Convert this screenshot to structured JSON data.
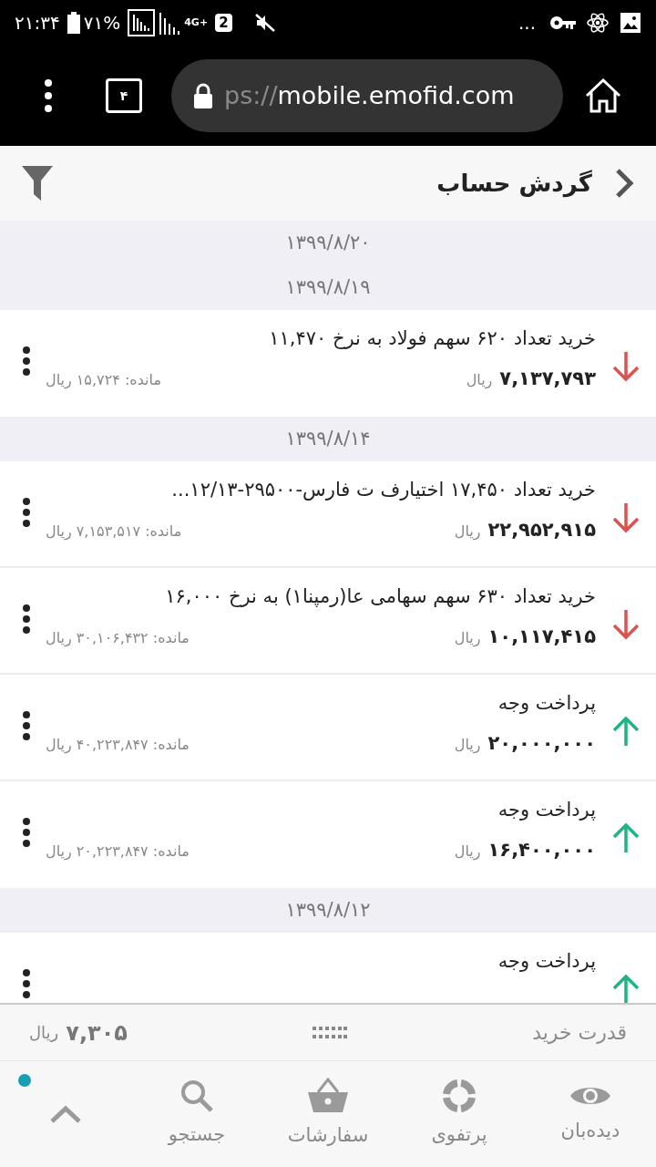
{
  "status_bar": {
    "time": "۲۱:۳۴",
    "battery": "۷۱%",
    "network": "4G+",
    "sim": "2",
    "more": "..."
  },
  "browser": {
    "tabs_count": "۴",
    "url_prefix": "ps://",
    "url_host": "mobile.emofid.com"
  },
  "header": {
    "title": "گردش حساب"
  },
  "groups": [
    {
      "date": "۱۳۹۹/۸/۲۰"
    },
    {
      "date": "۱۳۹۹/۸/۱۹",
      "rows": [
        {
          "kind": "debit",
          "title": "خرید تعداد ۶۲۰ سهم فولاد به نرخ ۱۱,۴۷۰",
          "amount": "۷,۱۳۷,۷۹۳",
          "currency": "ریال",
          "balance": "مانده: ۱۵,۷۲۴ ریال"
        }
      ]
    },
    {
      "date": "۱۳۹۹/۸/۱۴",
      "rows": [
        {
          "kind": "debit",
          "title": "خرید تعداد ۱۷,۴۵۰ اختیارف ت فارس-۲۹۵۰۰-۱۲/۱۳...",
          "amount": "۲۲,۹۵۲,۹۱۵",
          "currency": "ریال",
          "balance": "مانده: ۷,۱۵۳,۵۱۷ ریال"
        },
        {
          "kind": "debit",
          "title": "خرید تعداد ۶۳۰ سهم سهامی عا(رمپنا۱) به نرخ ۱۶,۰۰۰",
          "amount": "۱۰,۱۱۷,۴۱۵",
          "currency": "ریال",
          "balance": "مانده: ۳۰,۱۰۶,۴۳۲ ریال"
        },
        {
          "kind": "credit",
          "title": "پرداخت وجه",
          "amount": "۲۰,۰۰۰,۰۰۰",
          "currency": "ریال",
          "balance": "مانده: ۴۰,۲۲۳,۸۴۷ ریال"
        },
        {
          "kind": "credit",
          "title": "پرداخت وجه",
          "amount": "۱۶,۴۰۰,۰۰۰",
          "currency": "ریال",
          "balance": "مانده: ۲۰,۲۲۳,۸۴۷ ریال"
        }
      ]
    },
    {
      "date": "۱۳۹۹/۸/۱۲",
      "rows": [
        {
          "kind": "credit",
          "title": "پرداخت وجه"
        }
      ]
    }
  ],
  "summary": {
    "label": "قدرت خرید",
    "amount": "۷,۳۰۵",
    "currency": "ریال"
  },
  "nav": [
    {
      "kind": "eye",
      "label": "دیده‌بان"
    },
    {
      "kind": "donut",
      "label": "پرتفوی"
    },
    {
      "kind": "basket",
      "label": "سفارشات"
    },
    {
      "kind": "search",
      "label": "جستجو"
    },
    {
      "kind": "more"
    }
  ]
}
